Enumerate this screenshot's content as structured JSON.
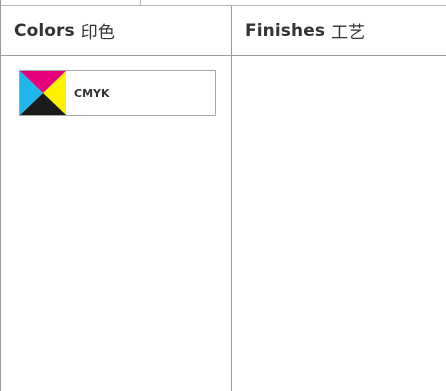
{
  "colors_panel": {
    "title": "Colors",
    "title_cn": "印色",
    "options": [
      {
        "label": "CMYK",
        "icon": "cmyk-swatch-icon",
        "swatch_colors": {
          "cyan": "#1fb6ee",
          "magenta": "#e6007e",
          "yellow": "#fff200",
          "black": "#1a1a1a"
        }
      }
    ]
  },
  "finishes_panel": {
    "title": "Finishes",
    "title_cn": "工艺"
  }
}
